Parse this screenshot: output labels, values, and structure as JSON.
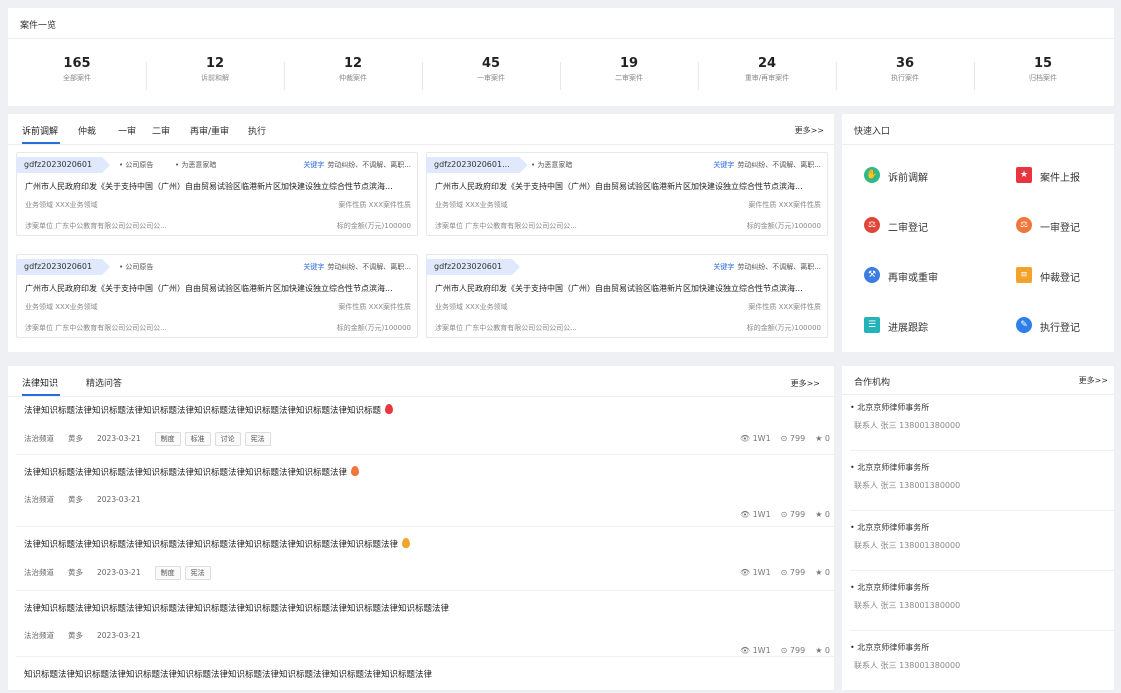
{
  "overview": {
    "title": "案件一览",
    "stats": [
      {
        "value": "165",
        "label": "全部案件"
      },
      {
        "value": "12",
        "label": "诉前和解"
      },
      {
        "value": "12",
        "label": "仲裁案件"
      },
      {
        "value": "45",
        "label": "一审案件"
      },
      {
        "value": "19",
        "label": "二审案件"
      },
      {
        "value": "24",
        "label": "重审/再审案件"
      },
      {
        "value": "36",
        "label": "执行案件"
      },
      {
        "value": "15",
        "label": "归档案件"
      }
    ]
  },
  "cases": {
    "tabs": [
      "诉前调解",
      "仲裁",
      "一审",
      "二审",
      "再审/重审",
      "执行"
    ],
    "more": "更多>>",
    "cards": [
      {
        "code": "gdfz2023020601",
        "tags": [
          "• 公司原告",
          "• 为恶意家暗"
        ],
        "kw_label": "关键字",
        "keywords": "劳动纠纷、不调解、离职...",
        "title": "广州市人民政府印发《关于支持中国（广州）自由贸易试验区临港新片区加快建设独立综合性节点滨海...",
        "field_label": "业务领域",
        "field": "XXX业务领域",
        "nature_label": "案件性质",
        "nature": "XXX案件性质",
        "unit_label": "涉案单位",
        "unit": "广东中公教育有限公司公司公司公...",
        "amount_label": "标的金额(万元)",
        "amount": "100000"
      },
      {
        "code": "gdfz2023020601...",
        "tags": [
          "• 为恶意家暗"
        ],
        "kw_label": "关键字",
        "keywords": "劳动纠纷、不调解、离职...",
        "title": "广州市人民政府印发《关于支持中国（广州）自由贸易试验区临港新片区加快建设独立综合性节点滨海...",
        "field_label": "业务领域",
        "field": "XXX业务领域",
        "nature_label": "案件性质",
        "nature": "XXX案件性质",
        "unit_label": "涉案单位",
        "unit": "广东中公教育有限公司公司公司公...",
        "amount_label": "标的金额(万元)",
        "amount": "100000"
      },
      {
        "code": "gdfz2023020601",
        "tags": [
          "• 公司原告"
        ],
        "kw_label": "关键字",
        "keywords": "劳动纠纷、不调解、离职...",
        "title": "广州市人民政府印发《关于支持中国（广州）自由贸易试验区临港新片区加快建设独立综合性节点滨海...",
        "field_label": "业务领域",
        "field": "XXX业务领域",
        "nature_label": "案件性质",
        "nature": "XXX案件性质",
        "unit_label": "涉案单位",
        "unit": "广东中公教育有限公司公司公司公...",
        "amount_label": "标的金额(万元)",
        "amount": "100000"
      },
      {
        "code": "gdfz2023020601",
        "tags": [],
        "kw_label": "关键字",
        "keywords": "劳动纠纷、不调解、离职...",
        "title": "广州市人民政府印发《关于支持中国（广州）自由贸易试验区临港新片区加快建设独立综合性节点滨海...",
        "field_label": "业务领域",
        "field": "XXX业务领域",
        "nature_label": "案件性质",
        "nature": "XXX案件性质",
        "unit_label": "涉案单位",
        "unit": "广东中公教育有限公司公司公司公...",
        "amount_label": "标的金额(万元)",
        "amount": "100000"
      }
    ]
  },
  "quick": {
    "title": "快速入口",
    "items": [
      {
        "label": "诉前调解",
        "icon": "handshake-icon",
        "glyph": "✋",
        "color": "#2fb889"
      },
      {
        "label": "案件上报",
        "icon": "report-icon",
        "glyph": "★",
        "color": "#e8353f"
      },
      {
        "label": "二审登记",
        "icon": "register-icon",
        "glyph": "⚖",
        "color": "#e0453a"
      },
      {
        "label": "一审登记",
        "icon": "register-icon",
        "glyph": "⚖",
        "color": "#f0763a"
      },
      {
        "label": "再审或重审",
        "icon": "retrial-icon",
        "glyph": "⚒",
        "color": "#3b7de0"
      },
      {
        "label": "仲裁登记",
        "icon": "arbitration-icon",
        "glyph": "≡",
        "color": "#f3a32a"
      },
      {
        "label": "进展跟踪",
        "icon": "progress-icon",
        "glyph": "☰",
        "color": "#22b3b8"
      },
      {
        "label": "执行登记",
        "icon": "execute-icon",
        "glyph": "✎",
        "color": "#2f7fe8"
      }
    ]
  },
  "knowledge": {
    "tabs": [
      "法律知识",
      "精选问答"
    ],
    "more": "更多>>",
    "items": [
      {
        "title": "法律知识标题法律知识标题法律知识标题法律知识标题法律知识标题法律知识标题法律知识标题",
        "fire": "#e8353f",
        "channel": "法治频道",
        "author": "黄多",
        "date": "2023-03-21",
        "tags": [
          "制度",
          "标准",
          "讨论",
          "宪法"
        ],
        "views": "1W1",
        "comments": "799",
        "likes": "0"
      },
      {
        "title": "法律知识标题法律知识标题法律知识标题法律知识标题法律知识标题法律知识标题法律",
        "fire": "#f0763a",
        "channel": "法治频道",
        "author": "黄多",
        "date": "2023-03-21",
        "tags": [],
        "views": "1W1",
        "comments": "799",
        "likes": "0"
      },
      {
        "title": "法律知识标题法律知识标题法律知识标题法律知识标题法律知识标题法律知识标题法律知识标题法律",
        "fire": "#f3a32a",
        "channel": "法治频道",
        "author": "黄多",
        "date": "2023-03-21",
        "tags": [
          "制度",
          "宪法"
        ],
        "views": "1W1",
        "comments": "799",
        "likes": "0"
      },
      {
        "title": "法律知识标题法律知识标题法律知识标题法律知识标题法律知识标题法律知识标题法律知识标题法律知识标题法律",
        "fire": "",
        "channel": "法治频道",
        "author": "黄多",
        "date": "2023-03-21",
        "tags": [],
        "views": "1W1",
        "comments": "799",
        "likes": "0"
      },
      {
        "title": "知识标题法律知识标题法律知识标题法律知识标题法律知识标题法律知识标题法律知识标题法律知识标题法律",
        "fire": "",
        "channel": "",
        "author": "",
        "date": "",
        "tags": [],
        "views": "",
        "comments": "",
        "likes": ""
      }
    ]
  },
  "partners": {
    "title": "合作机构",
    "more": "更多>>",
    "items": [
      {
        "name": "• 北京京师律师事务所",
        "contact_label": "联系人",
        "contact": "张三",
        "phone": "138001380000"
      },
      {
        "name": "• 北京京师律师事务所",
        "contact_label": "联系人",
        "contact": "张三",
        "phone": "138001380000"
      },
      {
        "name": "• 北京京师律师事务所",
        "contact_label": "联系人",
        "contact": "张三",
        "phone": "138001380000"
      },
      {
        "name": "• 北京京师律师事务所",
        "contact_label": "联系人",
        "contact": "张三",
        "phone": "138001380000"
      },
      {
        "name": "• 北京京师律师事务所",
        "contact_label": "联系人",
        "contact": "张三",
        "phone": "138001380000"
      }
    ]
  }
}
